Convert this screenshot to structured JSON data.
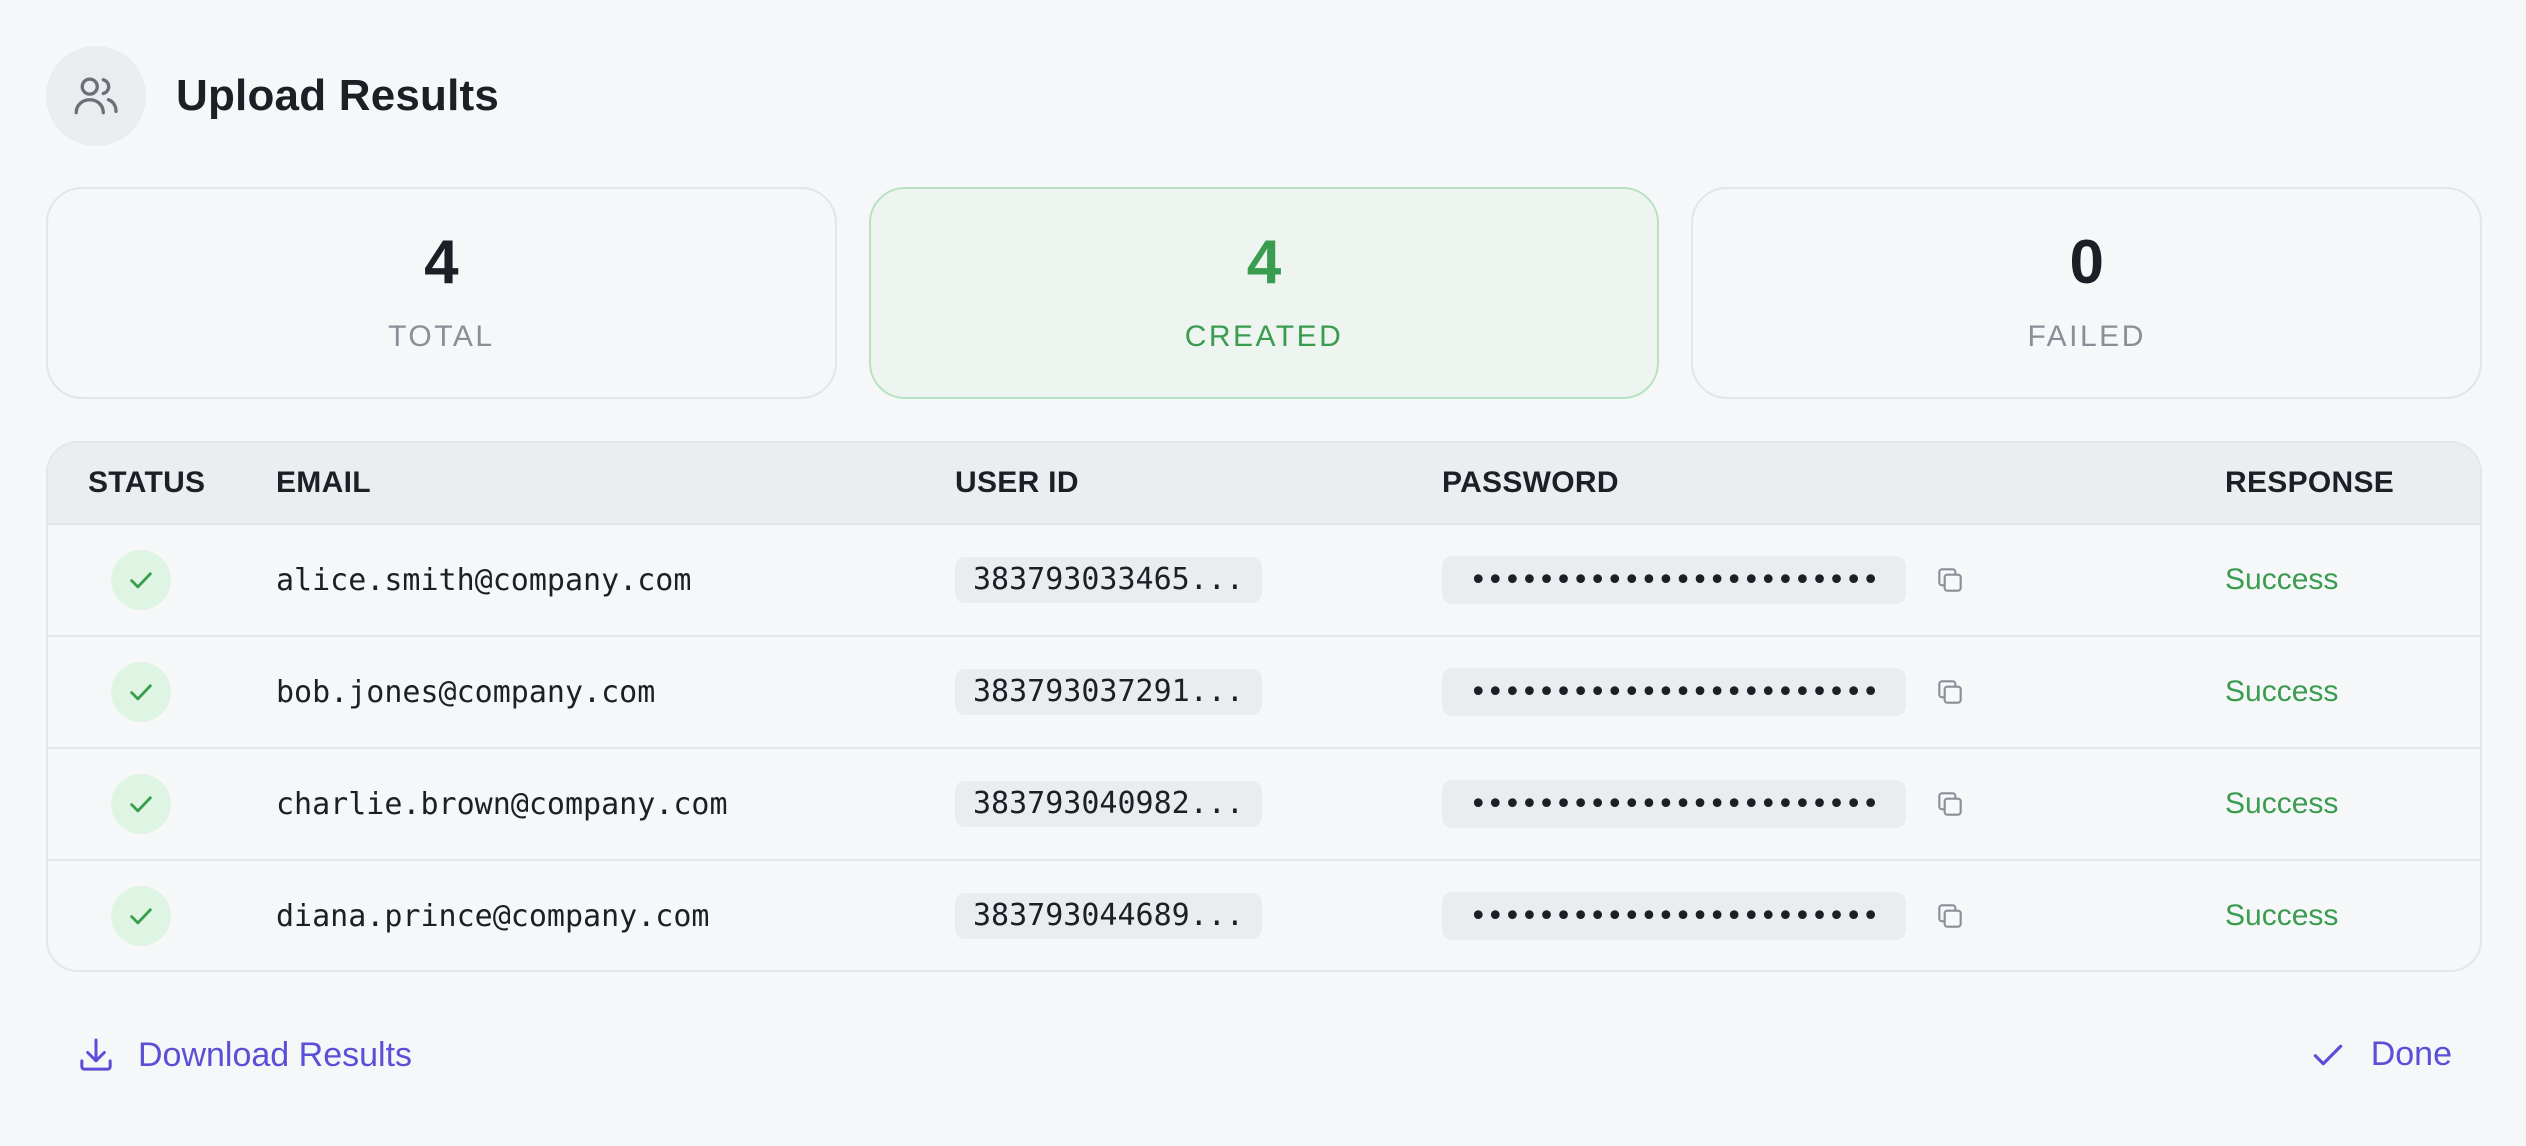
{
  "header": {
    "title": "Upload Results",
    "icon": "users-icon"
  },
  "stats": [
    {
      "value": "4",
      "label": "TOTAL"
    },
    {
      "value": "4",
      "label": "CREATED"
    },
    {
      "value": "0",
      "label": "FAILED"
    }
  ],
  "table": {
    "columns": [
      "STATUS",
      "EMAIL",
      "USER ID",
      "PASSWORD",
      "RESPONSE"
    ],
    "rows": [
      {
        "email": "alice.smith@company.com",
        "user_id": "383793033465...",
        "password": "••••••••••••••••••••••••",
        "response": "Success"
      },
      {
        "email": "bob.jones@company.com",
        "user_id": "383793037291...",
        "password": "••••••••••••••••••••••••",
        "response": "Success"
      },
      {
        "email": "charlie.brown@company.com",
        "user_id": "383793040982...",
        "password": "••••••••••••••••••••••••",
        "response": "Success"
      },
      {
        "email": "diana.prince@company.com",
        "user_id": "383793044689...",
        "password": "••••••••••••••••••••••••",
        "response": "Success"
      }
    ]
  },
  "footer": {
    "download_label": "Download Results",
    "done_label": "Done"
  },
  "colors": {
    "accent": "#5a4fd6",
    "success": "#3a9c4e",
    "success_bg": "#dff5e3"
  }
}
